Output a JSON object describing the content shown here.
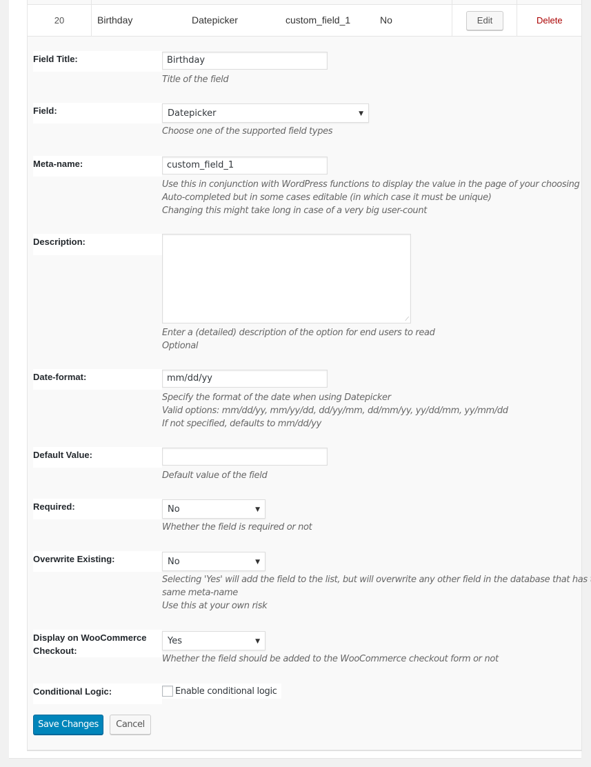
{
  "row": {
    "id": "20",
    "title": "Birthday",
    "type": "Datepicker",
    "meta_name": "custom_field_1",
    "required": "No",
    "edit_label": "Edit",
    "delete_label": "Delete"
  },
  "form": {
    "field_title": {
      "label": "Field Title:",
      "value": "Birthday",
      "description": "Title of the field"
    },
    "field": {
      "label": "Field:",
      "selected": "Datepicker",
      "description": "Choose one of the supported field types"
    },
    "meta_name": {
      "label": "Meta-name:",
      "value": "custom_field_1",
      "description": [
        "Use this in conjunction with WordPress functions to display the value in the page of your choosing",
        "Auto-completed but in some cases editable (in which case it must be unique)",
        "Changing this might take long in case of a very big user-count"
      ]
    },
    "description": {
      "label": "Description:",
      "value": "",
      "description": [
        "Enter a (detailed) description of the option for end users to read",
        "Optional"
      ]
    },
    "date_format": {
      "label": "Date-format:",
      "value": "mm/dd/yy",
      "description": [
        "Specify the format of the date when using Datepicker",
        "Valid options: mm/dd/yy, mm/yy/dd, dd/yy/mm, dd/mm/yy, yy/dd/mm, yy/mm/dd",
        "If not specified, defaults to mm/dd/yy"
      ]
    },
    "default_value": {
      "label": "Default Value:",
      "value": "",
      "description": "Default value of the field"
    },
    "required": {
      "label": "Required:",
      "selected": "No",
      "description": "Whether the field is required or not"
    },
    "overwrite_existing": {
      "label": "Overwrite Existing:",
      "selected": "No",
      "description": [
        "Selecting 'Yes' will add the field to the list, but will overwrite any other field in the database that has the",
        "same meta-name",
        "Use this at your own risk"
      ]
    },
    "woocommerce_checkout": {
      "label_line1": "Display on WooCommerce",
      "label_line2": "Checkout:",
      "selected": "Yes",
      "description": "Whether the field should be added to the WooCommerce checkout form or not"
    },
    "conditional_logic": {
      "label": "Conditional Logic:",
      "checkbox_label": "Enable conditional logic",
      "checked": false
    }
  },
  "actions": {
    "save_label": "Save Changes",
    "cancel_label": "Cancel"
  },
  "icons": {
    "dropdown_arrow": "▼",
    "resize_grip": "⟋"
  },
  "colors": {
    "primary": "#0085ba",
    "delete": "#aa0000",
    "panel_bg": "#f9f9f9",
    "page_bg": "#f1f1f1"
  }
}
